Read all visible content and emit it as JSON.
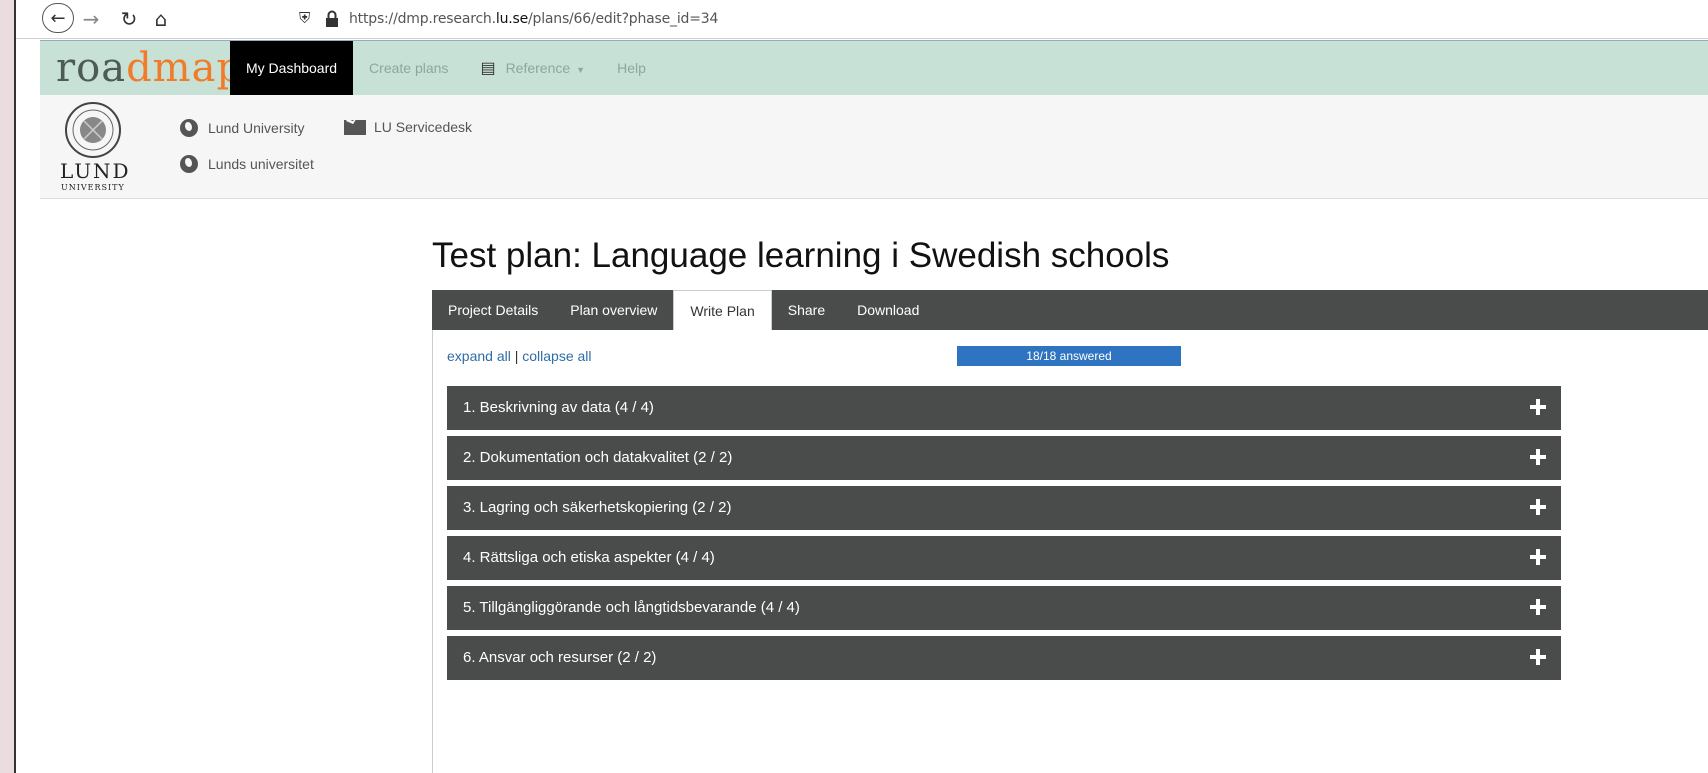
{
  "browser": {
    "url_prefix": "https://dmp.research.",
    "url_domain": "lu.se",
    "url_suffix": "/plans/66/edit?phase_id=34"
  },
  "header": {
    "logo_part1": "roa",
    "logo_part2": "dmap",
    "menu": [
      {
        "label": "My Dashboard"
      },
      {
        "label": "Create plans"
      },
      {
        "label": "Reference"
      },
      {
        "label": "Help"
      }
    ]
  },
  "org": {
    "lund_word": "LUND",
    "university_word": "UNIVERSITY",
    "links": [
      {
        "label": "Lund University"
      },
      {
        "label": "LU Servicedesk"
      },
      {
        "label": "Lunds universitet"
      }
    ]
  },
  "plan": {
    "title": "Test plan: Language learning i Swedish schools",
    "tabs": [
      {
        "label": "Project Details"
      },
      {
        "label": "Plan overview"
      },
      {
        "label": "Write Plan"
      },
      {
        "label": "Share"
      },
      {
        "label": "Download"
      }
    ],
    "expand_all": "expand all",
    "separator": "|",
    "collapse_all": "collapse all",
    "progress_text": "18/18 answered",
    "progress_fraction": 1.0,
    "sections": [
      {
        "label": "1. Beskrivning av data (4 / 4)"
      },
      {
        "label": "2. Dokumentation och datakvalitet (2 / 2)"
      },
      {
        "label": "3. Lagring och säkerhetskopiering (2 / 2)"
      },
      {
        "label": "4. Rättsliga och etiska aspekter (4 / 4)"
      },
      {
        "label": "5. Tillgängliggörande och långtidsbevarande (4 / 4)"
      },
      {
        "label": "6. Ansvar och resurser (2 / 2)"
      }
    ]
  },
  "colors": {
    "header_bg": "#c8e1d7",
    "logo_accent": "#f07c2a",
    "tabbar_bg": "#4a4b4b",
    "progress_bg": "#2f74c0",
    "link": "#2f6da5"
  }
}
